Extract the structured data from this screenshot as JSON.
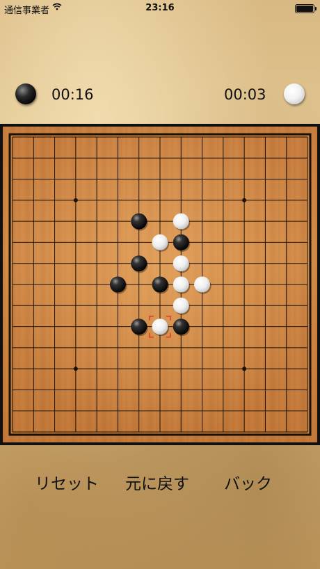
{
  "status_bar": {
    "carrier": "通信事業者",
    "time": "23:16"
  },
  "players": {
    "black": {
      "timer": "00:16"
    },
    "white": {
      "timer": "00:03"
    }
  },
  "board": {
    "size": 15,
    "star_points": [
      [
        3,
        3
      ],
      [
        11,
        3
      ],
      [
        3,
        11
      ],
      [
        11,
        11
      ]
    ],
    "stones": [
      {
        "color": "black",
        "col": 6,
        "row": 4
      },
      {
        "color": "white",
        "col": 8,
        "row": 4
      },
      {
        "color": "white",
        "col": 7,
        "row": 5
      },
      {
        "color": "black",
        "col": 8,
        "row": 5
      },
      {
        "color": "black",
        "col": 6,
        "row": 6
      },
      {
        "color": "white",
        "col": 8,
        "row": 6
      },
      {
        "color": "black",
        "col": 5,
        "row": 7
      },
      {
        "color": "black",
        "col": 7,
        "row": 7
      },
      {
        "color": "white",
        "col": 8,
        "row": 7
      },
      {
        "color": "white",
        "col": 9,
        "row": 7
      },
      {
        "color": "white",
        "col": 8,
        "row": 8
      },
      {
        "color": "black",
        "col": 6,
        "row": 9
      },
      {
        "color": "white",
        "col": 7,
        "row": 9
      },
      {
        "color": "black",
        "col": 8,
        "row": 9
      }
    ],
    "last_move": {
      "col": 7,
      "row": 9
    },
    "marker_color": "#e03a1a"
  },
  "controls": {
    "reset": "リセット",
    "undo": "元に戻す",
    "back": "バック"
  },
  "colors": {
    "line": "#1a1208",
    "frame": "#111111"
  }
}
